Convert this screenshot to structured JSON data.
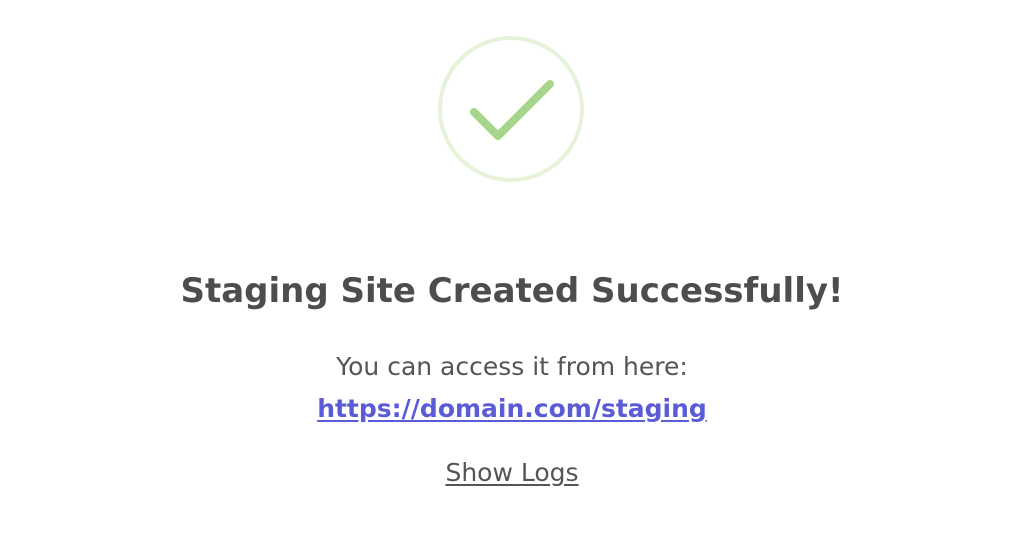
{
  "success": {
    "icon": "checkmark-circle-icon",
    "title": "Staging Site Created Successfully!",
    "access_text": "You can access it from here:",
    "link_text": "https://domain.com/staging",
    "show_logs_label": "Show Logs"
  },
  "colors": {
    "circle_ring": "#e6f3d9",
    "checkmark": "#a6d68a",
    "title": "#4d4d4d",
    "body_text": "#555555",
    "link": "#5b5bd6"
  }
}
